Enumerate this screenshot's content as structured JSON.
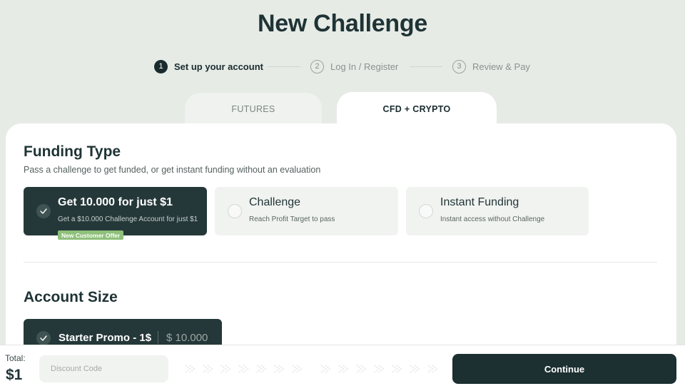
{
  "page": {
    "title": "New Challenge"
  },
  "stepper": {
    "steps": [
      {
        "number": "1",
        "label": "Set up your account"
      },
      {
        "number": "2",
        "label": "Log In / Register"
      },
      {
        "number": "3",
        "label": "Review & Pay"
      }
    ]
  },
  "tabs": [
    {
      "label": "FUTURES"
    },
    {
      "label": "CFD + CRYPTO"
    }
  ],
  "funding": {
    "title": "Funding Type",
    "subtitle": "Pass a challenge to get funded, or get instant funding without an evaluation",
    "options": [
      {
        "title": "Get 10.000 for just $1",
        "subtitle": "Get a $10.000 Challenge Account for just $1",
        "badge": "New Customer Offer"
      },
      {
        "title": "Challenge",
        "subtitle": "Reach Profit Target to pass"
      },
      {
        "title": "Instant Funding",
        "subtitle": "Instant access without Challenge"
      }
    ]
  },
  "account_size": {
    "title": "Account Size",
    "option": {
      "label": "Starter Promo - 1$",
      "value": "$ 10.000"
    }
  },
  "footer": {
    "total_label": "Total:",
    "total_value": "$1",
    "discount_placeholder": "Discount Code",
    "continue_label": "Continue"
  },
  "colors": {
    "primary_dark": "#1c2f31",
    "selected_card": "#253839",
    "badge_green": "#8ec07a",
    "page_bg": "#e6ebe6"
  }
}
